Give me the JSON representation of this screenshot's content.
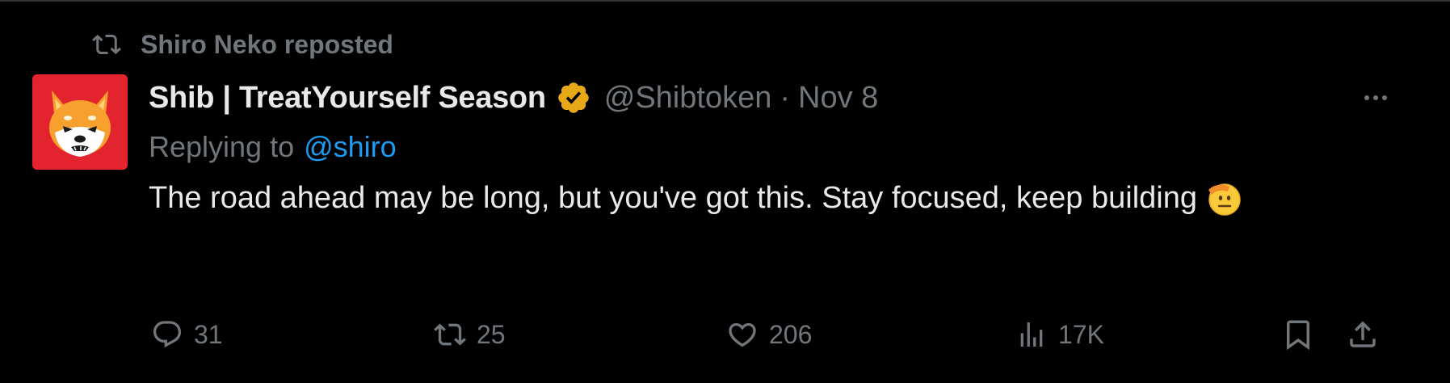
{
  "repost": {
    "label": "Shiro Neko reposted",
    "icon": "repost-icon"
  },
  "tweet": {
    "author_name": "Shib | TreatYourself Season",
    "verified_icon": "verified-badge-gold",
    "handle": "@Shibtoken",
    "separator": "·",
    "date": "Nov 8",
    "replying_prefix": "Replying to",
    "replying_mention": "@shiro",
    "text": "The road ahead may be long, but you've got this. Stay focused, keep building",
    "emoji": "saluting-face"
  },
  "actions": {
    "replies": "31",
    "reposts": "25",
    "likes": "206",
    "views": "17K"
  },
  "colors": {
    "background": "#000000",
    "text": "#e7e9ea",
    "muted": "#71767b",
    "accent": "#1d9bf0",
    "avatar_bg": "#e3232d",
    "verified": "#e6a817"
  }
}
